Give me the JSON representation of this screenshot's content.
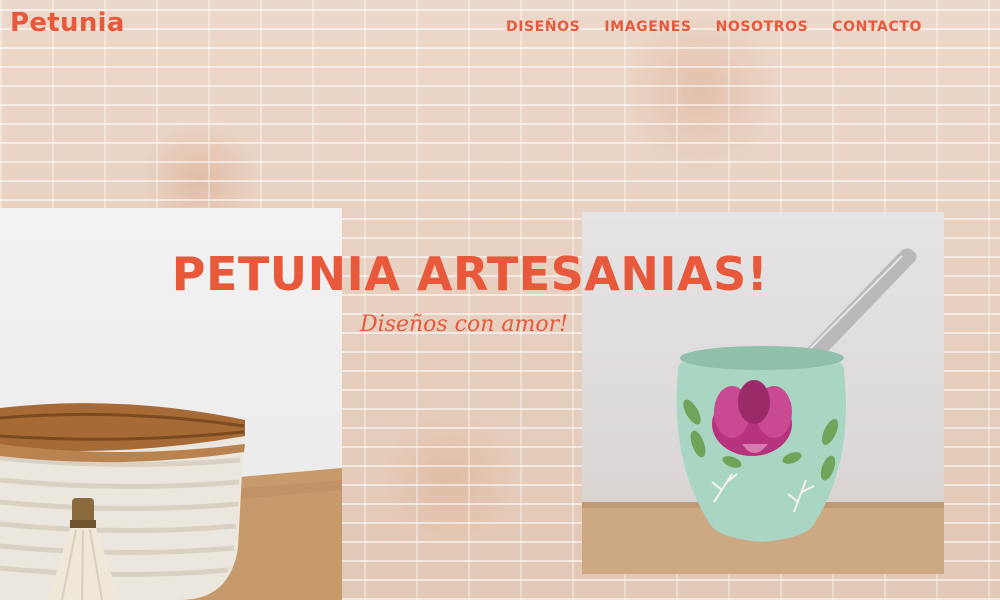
{
  "header": {
    "brand": "Petunia",
    "nav": [
      "DISEÑOS",
      "IMAGENES",
      "NOSOTROS",
      "CONTACTO"
    ]
  },
  "hero": {
    "title": "PETUNIA ARTESANIAS!",
    "subtitle": "Diseños con amor!"
  },
  "colors": {
    "accent": "#e8583a",
    "wall": "#e6cfc0"
  },
  "images": {
    "left": "crochet-basket-photo",
    "right": "painted-mate-cup-photo"
  }
}
